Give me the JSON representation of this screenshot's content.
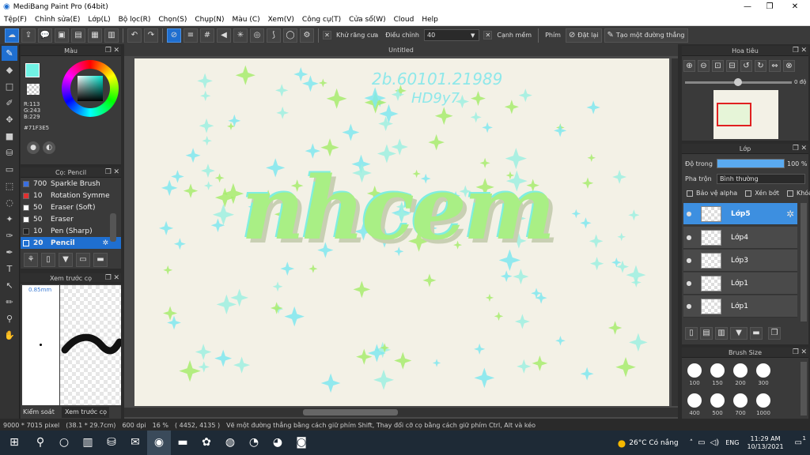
{
  "window": {
    "title": "MediBang Paint Pro (64bit)",
    "min": "—",
    "max": "❐",
    "close": "✕"
  },
  "menu": [
    "Tệp(F)",
    "Chỉnh sửa(E)",
    "Lớp(L)",
    "Bộ lọc(R)",
    "Chọn(S)",
    "Chụp(N)",
    "Màu (C)",
    "Xem(V)",
    "Công cụ(T)",
    "Cửa sổ(W)",
    "Cloud",
    "Help"
  ],
  "toolbar": {
    "antialias_label": "Khử răng cưa",
    "adjust_label": "Điều chỉnh",
    "adjust_value": "40",
    "edge_label": "Cạnh mềm",
    "key_label": "Phím",
    "set_label": "Đặt lại",
    "straight_label": "Tạo một đường thẳng"
  },
  "color_panel": {
    "title": "Màu",
    "r": "R:113",
    "g": "G:243",
    "b": "B:229",
    "hex": "#71F3E5",
    "primary": "#71F3E5"
  },
  "brush_panel": {
    "title": "Cọ: Pencil",
    "items": [
      {
        "size": "700",
        "name": "Sparkle Brush",
        "color": "#3a6fe0"
      },
      {
        "size": "10",
        "name": "Rotation Symme",
        "color": "#e03030"
      },
      {
        "size": "50",
        "name": "Eraser (Soft)",
        "color": "#ffffff"
      },
      {
        "size": "50",
        "name": "Eraser",
        "color": "#ffffff"
      },
      {
        "size": "10",
        "name": "Pen (Sharp)",
        "color": "#222222"
      },
      {
        "size": "20",
        "name": "Pencil",
        "color": "#1f6fd0"
      }
    ]
  },
  "preview_panel": {
    "title": "Xem trước cọ",
    "size": "0.85mm",
    "tab1": "Kiểm soát cọ",
    "tab2": "Xem trước cọ"
  },
  "canvas": {
    "doc_title": "Untitled",
    "word": "nhcem",
    "handwriting1": "2b.60101.21989",
    "handwriting2": "HD9y7"
  },
  "navigator": {
    "title": "Hoa tiêu",
    "angle": "0 độ"
  },
  "layer_panel": {
    "title": "Lớp",
    "opacity_label": "Độ trong",
    "opacity_value": "100 %",
    "blend_label": "Pha trộn",
    "blend_value": "Bình thường",
    "protect_alpha": "Bảo vệ alpha",
    "clip": "Xén bớt",
    "lock": "Khóa",
    "layers": [
      "Lớp5",
      "Lớp4",
      "Lớp3",
      "Lớp1",
      "Lớp1"
    ]
  },
  "brush_size": {
    "title": "Brush Size",
    "sizes": [
      "100",
      "150",
      "200",
      "300",
      "400",
      "500",
      "700",
      "1000"
    ]
  },
  "status": {
    "dims": "9000 * 7015 pixel",
    "cm": "(38.1 * 29.7cm)",
    "dpi": "600 dpi",
    "zoom": "16 %",
    "coords": "( 4452, 4135 )",
    "hint": "Vẽ một đường thẳng bằng cách giữ phím Shift, Thay đổi cỡ cọ bằng cách giữ phím Ctrl, Alt và kéo"
  },
  "taskbar": {
    "weather": "26°C  Có nắng",
    "lang": "ENG",
    "time": "11:29 AM",
    "date": "10/13/2021",
    "notif": "1"
  }
}
